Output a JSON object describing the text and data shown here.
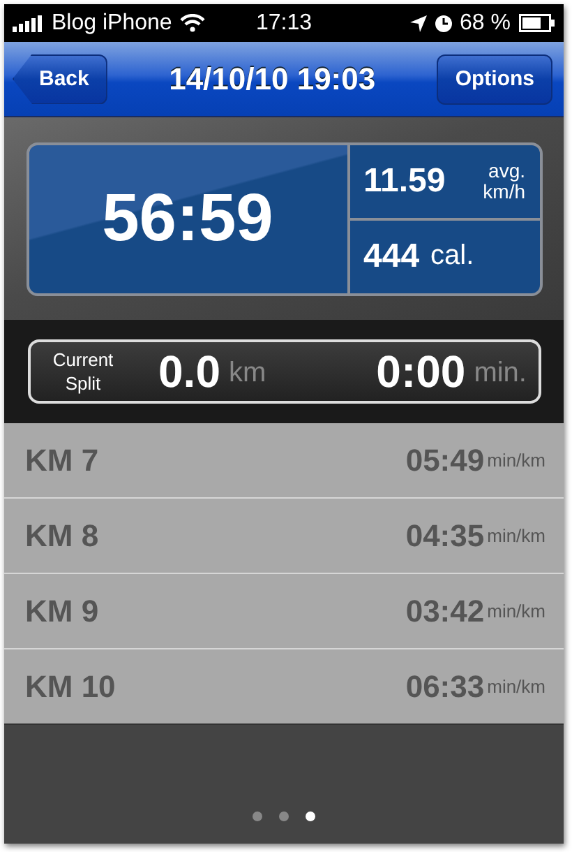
{
  "status_bar": {
    "carrier": "Blog iPhone",
    "time": "17:13",
    "battery": "68 %"
  },
  "nav_bar": {
    "back": "Back",
    "title": "14/10/10 19:03",
    "action": "Options"
  },
  "summary": {
    "duration": "56:59",
    "speed": "11.59",
    "speed_unit_top": "avg.",
    "speed_unit_bottom": "km/h",
    "calories": "444",
    "calories_unit": "cal."
  },
  "current_split": {
    "label_top": "Current",
    "label_bottom": "Split",
    "distance": "0.0",
    "distance_unit": "km",
    "time": "0:00",
    "time_unit": "min."
  },
  "splits": [
    {
      "label": "KM 7",
      "pace": "05:49",
      "unit": "min/km"
    },
    {
      "label": "KM 8",
      "pace": "04:35",
      "unit": "min/km"
    },
    {
      "label": "KM 9",
      "pace": "03:42",
      "unit": "min/km"
    },
    {
      "label": "KM 10",
      "pace": "06:33",
      "unit": "min/km"
    }
  ],
  "page_dots": [
    {
      "selected": false
    },
    {
      "selected": false
    },
    {
      "selected": true
    }
  ]
}
